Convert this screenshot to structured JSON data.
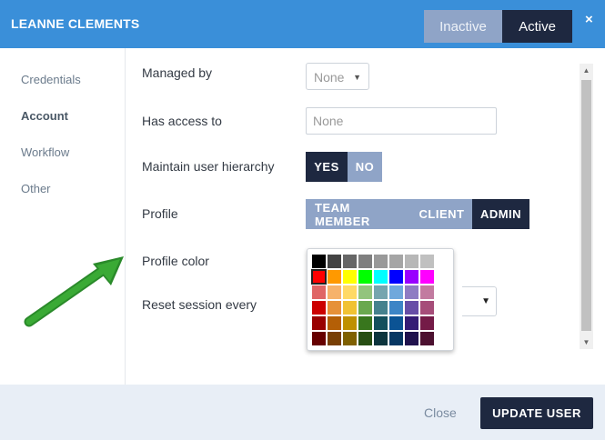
{
  "header": {
    "title": "LEANNE CLEMENTS",
    "status_inactive": "Inactive",
    "status_active": "Active",
    "close_glyph": "×"
  },
  "sidebar": {
    "items": [
      {
        "label": "Credentials"
      },
      {
        "label": "Account"
      },
      {
        "label": "Workflow"
      },
      {
        "label": "Other"
      }
    ],
    "active": "Account"
  },
  "form": {
    "managed_by": {
      "label": "Managed by",
      "value": "None",
      "caret": "▼"
    },
    "has_access": {
      "label": "Has access to",
      "placeholder": "None"
    },
    "hierarchy": {
      "label": "Maintain user hierarchy",
      "yes": "YES",
      "no": "NO",
      "selected": "YES"
    },
    "profile": {
      "label": "Profile",
      "options": [
        "TEAM MEMBER",
        "CLIENT",
        "ADMIN"
      ],
      "selected": "ADMIN"
    },
    "profile_color": {
      "label": "Profile color",
      "selected_color": "#ff0000"
    },
    "reset_session": {
      "label": "Reset session every",
      "caret": "▼"
    }
  },
  "palette": {
    "rows": [
      [
        "#000000",
        "#434343",
        "#666666",
        "#7f7f7f",
        "#999999",
        "#a5a5a5",
        "#b7b7b7",
        "#c0c0c0"
      ],
      [
        "#ff0000",
        "#ff9900",
        "#ffff00",
        "#00ff00",
        "#00ffff",
        "#0000ff",
        "#9900ff",
        "#ff00ff"
      ],
      [
        "#e06666",
        "#f6b26b",
        "#ffd966",
        "#93c47d",
        "#76a5af",
        "#6fa8dc",
        "#8e7cc3",
        "#c27ba0"
      ],
      [
        "#cc0000",
        "#e69138",
        "#f1c232",
        "#6aa84f",
        "#45818e",
        "#3d85c6",
        "#674ea7",
        "#a64d79"
      ],
      [
        "#990000",
        "#b45f06",
        "#bf9000",
        "#38761d",
        "#134f5c",
        "#0b5394",
        "#351c75",
        "#741b47"
      ],
      [
        "#660000",
        "#783f04",
        "#7f6000",
        "#274e13",
        "#0c343d",
        "#073763",
        "#20124d",
        "#4c1130"
      ]
    ]
  },
  "scrollbar": {
    "up": "▲",
    "down": "▼"
  },
  "footer": {
    "close_label": "Close",
    "update_label": "UPDATE USER"
  },
  "colors": {
    "header_bg": "#3a8fd9",
    "dark_navy": "#1e2840",
    "muted_blue": "#8fa4c7",
    "arrow_green": "#3aaa35"
  },
  "annotation": {
    "icon": "green-arrow-icon"
  }
}
